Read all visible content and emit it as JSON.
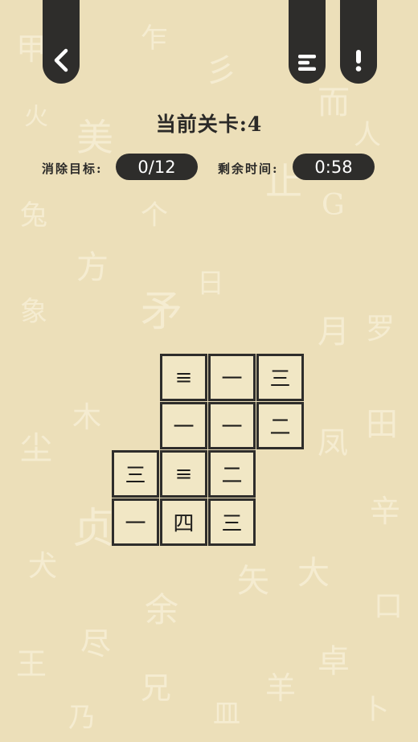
{
  "header": {
    "back_icon": "chevron-left-icon",
    "menu_icon": "menu-icon",
    "info_icon": "exclamation-icon"
  },
  "level": {
    "title": "当前关卡:4"
  },
  "stats": {
    "goal_label": "消除目标:",
    "goal_value": "0/12",
    "time_label": "剩余时间:",
    "time_value": "0:58"
  },
  "board": {
    "rows": [
      [
        "",
        "≡",
        "一",
        "三"
      ],
      [
        "",
        "一",
        "一",
        "二"
      ],
      [
        "三",
        "≡",
        "二",
        ""
      ],
      [
        "一",
        "四",
        "三",
        ""
      ]
    ]
  }
}
